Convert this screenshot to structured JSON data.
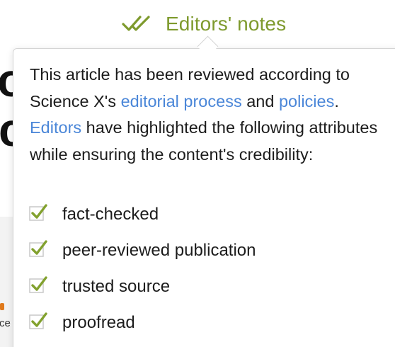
{
  "background": {
    "fragment_line1": "o",
    "fragment_line2": "ci",
    "fragment_small": "ce"
  },
  "header": {
    "label": "Editors' notes",
    "icon": "double-check-icon"
  },
  "popover": {
    "intro_part1": "This article has been reviewed according to Science X's ",
    "link_editorial_process": "editorial process",
    "intro_part2": " and ",
    "link_policies": "policies",
    "intro_part3": ". ",
    "link_editors": "Editors",
    "intro_part4": " have highlighted the following attributes while ensuring the content's credibility:",
    "attributes": [
      {
        "label": "fact-checked",
        "icon": "check-icon"
      },
      {
        "label": "peer-reviewed publication",
        "icon": "check-icon"
      },
      {
        "label": "trusted source",
        "icon": "check-icon"
      },
      {
        "label": "proofread",
        "icon": "check-icon"
      }
    ]
  },
  "colors": {
    "accent_green": "#7e9a2d",
    "link_blue": "#4a86d8",
    "check_green": "#82a12e"
  }
}
